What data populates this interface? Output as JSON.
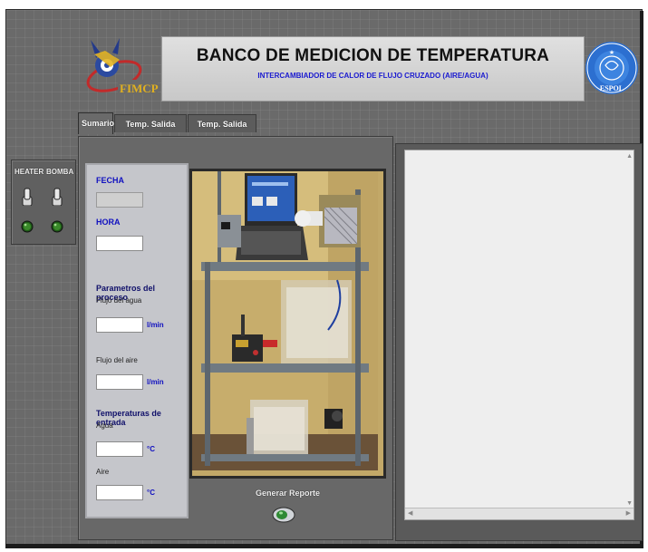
{
  "header": {
    "title": "BANCO DE MEDICION DE TEMPERATURA",
    "subtitle": "INTERCAMBIADOR DE CALOR DE FLUJO CRUZADO (AIRE/AGUA)",
    "logo_left_text": "FIMCP",
    "logo_right_text": "ESPOL"
  },
  "tabs": [
    {
      "label": "Sumario",
      "active": true
    },
    {
      "label": "Temp. Salida Agua",
      "active": false
    },
    {
      "label": "Temp. Salida Aire",
      "active": false
    }
  ],
  "controls": {
    "heater_label": "HEATER",
    "bomba_label": "BOMBA"
  },
  "form": {
    "fecha_label": "FECHA",
    "fecha_value": "",
    "hora_label": "HORA",
    "hora_value": "",
    "params_heading": "Parametros del proceso",
    "flujo_agua_label": "Flujo del agua",
    "flujo_agua_value": "",
    "flujo_agua_unit": "l/min",
    "flujo_aire_label": "Flujo del aire",
    "flujo_aire_value": "",
    "flujo_aire_unit": "l/min",
    "temps_heading": "Temperaturas de entrada",
    "agua_label": "Agua",
    "agua_value": "",
    "agua_unit": "°C",
    "aire_label": "Aire",
    "aire_value": "",
    "aire_unit": "°C"
  },
  "report": {
    "button_label": "Generar Reporte",
    "scroll_up": "▲",
    "scroll_down": "▼",
    "scroll_left": "◀",
    "scroll_right": "▶"
  },
  "colors": {
    "panel_gray": "#686868",
    "label_blue": "#1010c0",
    "led_green": "#3a8a2a",
    "title_blue": "#1a1ad0"
  }
}
